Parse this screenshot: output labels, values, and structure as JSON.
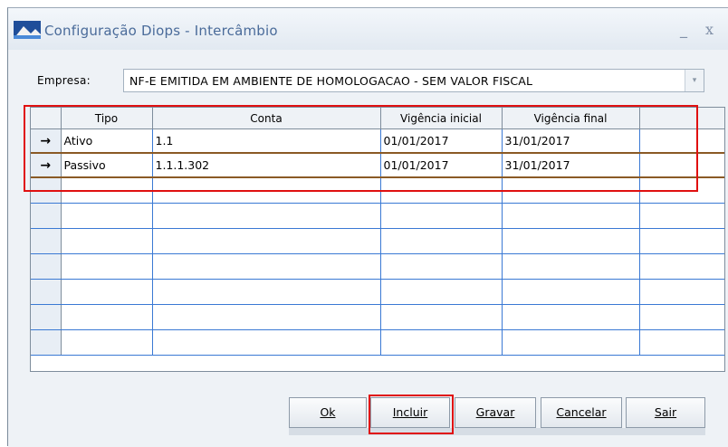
{
  "window": {
    "title": "Configuração Diops - Intercâmbio",
    "minimize_glyph": "_",
    "close_glyph": "x"
  },
  "empresa": {
    "label": "Empresa:",
    "value": "NF-E EMITIDA EM AMBIENTE DE HOMOLOGACAO - SEM VALOR FISCAL",
    "arrow": "▾"
  },
  "grid": {
    "columns": [
      "Tipo",
      "Conta",
      "Vigência inicial",
      "Vigência final"
    ],
    "rows": [
      {
        "indicator": "→",
        "tipo": "Ativo",
        "conta": "1.1",
        "vigencia_inicial": "01/01/2017",
        "vigencia_final": "31/01/2017"
      },
      {
        "indicator": "→",
        "tipo": "Passivo",
        "conta": "1.1.1.302",
        "vigencia_inicial": "01/01/2017",
        "vigencia_final": "31/01/2017"
      }
    ],
    "empty_row_count": 7
  },
  "buttons": {
    "ok": "Ok",
    "incluir": "Incluir",
    "gravar": "Gravar",
    "cancelar": "Cancelar",
    "sair": "Sair"
  },
  "colors": {
    "highlight": "#e01010",
    "grid_line": "#3a79d4",
    "row_separator": "#8a5a25",
    "title_text": "#4a6b9a"
  }
}
